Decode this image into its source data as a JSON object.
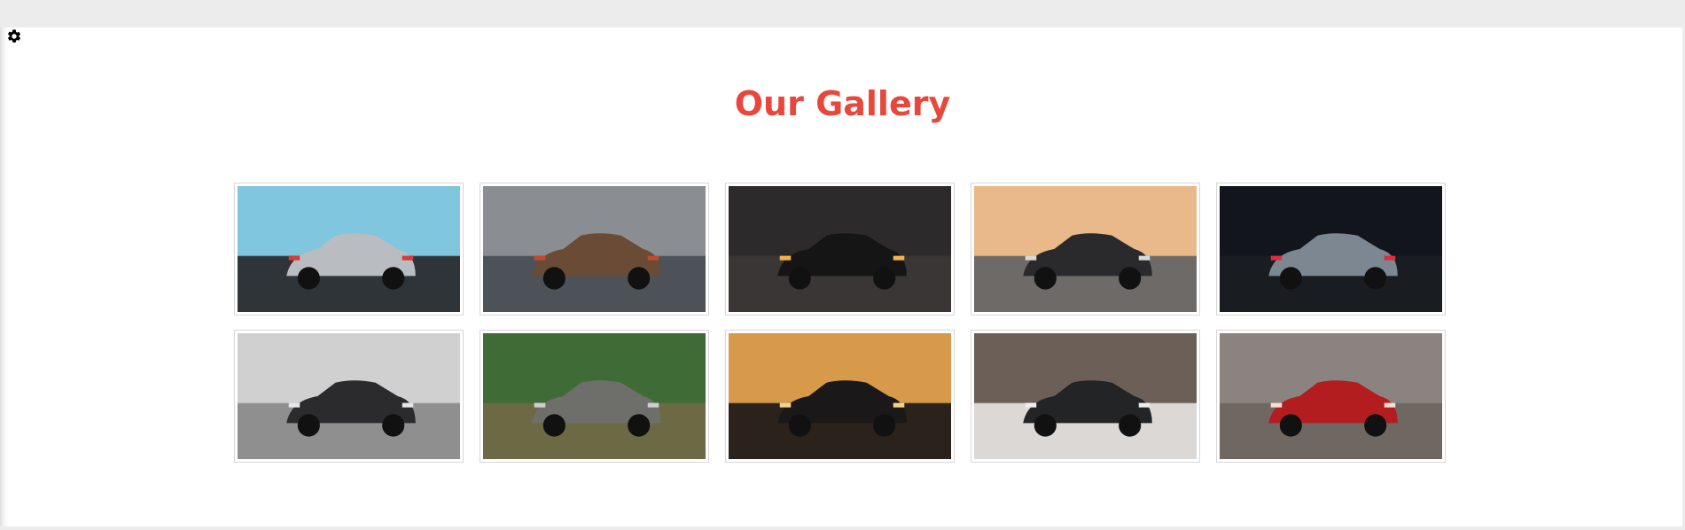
{
  "gallery": {
    "title": "Our Gallery",
    "title_color": "#e8473b",
    "images": [
      {
        "icon": "car-photo-silver-gtr-snowy-forest",
        "sky": "#7fc6de",
        "ground": "#2e3438",
        "car": "#b9bcc0",
        "light": "#d63a3a"
      },
      {
        "icon": "car-photo-bronze-lamborghini-cloudy",
        "sky": "#8a8d91",
        "ground": "#4d5258",
        "car": "#6a4b35",
        "light": "#c44a2c"
      },
      {
        "icon": "car-photo-black-challenger-driveway",
        "sky": "#2c2a2b",
        "ground": "#3a3635",
        "car": "#151516",
        "light": "#f3b24a"
      },
      {
        "icon": "car-photo-bugatti-desert-sunset",
        "sky": "#e9b989",
        "ground": "#6d6a68",
        "car": "#2a2a2c",
        "light": "#d9d9d9"
      },
      {
        "icon": "car-photo-grey-bmw-neon-night",
        "sky": "#12161c",
        "ground": "#191d22",
        "car": "#7c8791",
        "light": "#e02d3d"
      },
      {
        "icon": "car-photo-black-mercedes-amg-road",
        "sky": "#cfd0cf",
        "ground": "#8f8f8f",
        "car": "#2b2b2d",
        "light": "#e6e6e6"
      },
      {
        "icon": "car-photo-grey-tacoma-jungle",
        "sky": "#3f6b36",
        "ground": "#6c6a45",
        "car": "#6e6f6b",
        "light": "#cfcfcf"
      },
      {
        "icon": "car-photo-black-mustang-golden-hour",
        "sky": "#d69a4a",
        "ground": "#2c221c",
        "car": "#1a1818",
        "light": "#f0d590"
      },
      {
        "icon": "car-photo-black-gmc-yukon-snow",
        "sky": "#6b5f57",
        "ground": "#dcd8d6",
        "car": "#232426",
        "light": "#eeeeee"
      },
      {
        "icon": "car-photo-red-ferrari-old-town",
        "sky": "#8a8380",
        "ground": "#6f6762",
        "car": "#b41d1f",
        "light": "#f2e0d0"
      }
    ]
  }
}
